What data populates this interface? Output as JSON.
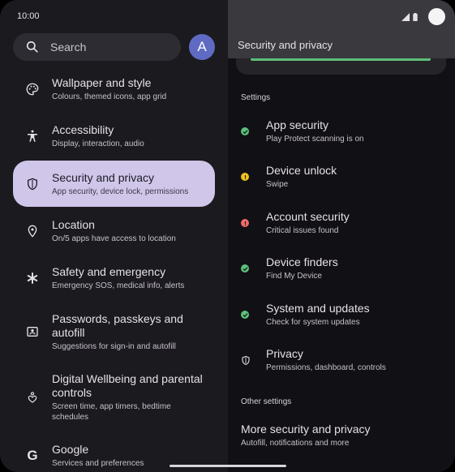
{
  "status": {
    "time": "10:00"
  },
  "search": {
    "placeholder": "Search"
  },
  "account": {
    "avatar_letter": "A"
  },
  "menu": [
    {
      "title": "Wallpaper and style",
      "subtitle": "Colours, themed icons, app grid",
      "icon": "palette-icon"
    },
    {
      "title": "Accessibility",
      "subtitle": "Display, interaction, audio",
      "icon": "accessibility-icon"
    },
    {
      "title": "Security and privacy",
      "subtitle": "App security, device lock, permissions",
      "icon": "shield-icon",
      "active": true
    },
    {
      "title": "Location",
      "subtitle": "On/5 apps have access to location",
      "icon": "location-pin-icon"
    },
    {
      "title": "Safety and emergency",
      "subtitle": "Emergency SOS, medical info, alerts",
      "icon": "asterisk-icon"
    },
    {
      "title": "Passwords, passkeys and autofill",
      "subtitle": "Suggestions for sign-in and autofill",
      "icon": "id-card-icon"
    },
    {
      "title": "Digital Wellbeing and parental controls",
      "subtitle": "Screen time, app timers, bedtime schedules",
      "icon": "wellbeing-icon"
    },
    {
      "title": "Google",
      "subtitle": "Services and preferences",
      "icon": "google-g-icon"
    }
  ],
  "detail": {
    "title": "Security and privacy",
    "settings_label": "Settings",
    "items": [
      {
        "title": "App security",
        "subtitle": "Play Protect scanning is on",
        "status": "ok"
      },
      {
        "title": "Device unlock",
        "subtitle": "Swipe",
        "status": "warning"
      },
      {
        "title": "Account security",
        "subtitle": "Critical issues found",
        "status": "critical"
      },
      {
        "title": "Device finders",
        "subtitle": "Find My Device",
        "status": "ok"
      },
      {
        "title": "System and updates",
        "subtitle": "Check for system updates",
        "status": "ok"
      },
      {
        "title": "Privacy",
        "subtitle": "Permissions, dashboard, controls",
        "status": "shield"
      }
    ],
    "other_label": "Other settings",
    "more": {
      "title": "More security and privacy",
      "subtitle": "Autofill, notifications and more"
    }
  },
  "colors": {
    "ok": "#5cc07a",
    "warning": "#f2c21b",
    "critical": "#ee6b6b",
    "active_bg": "#cfc6e9",
    "avatar": "#5f6bc2"
  }
}
